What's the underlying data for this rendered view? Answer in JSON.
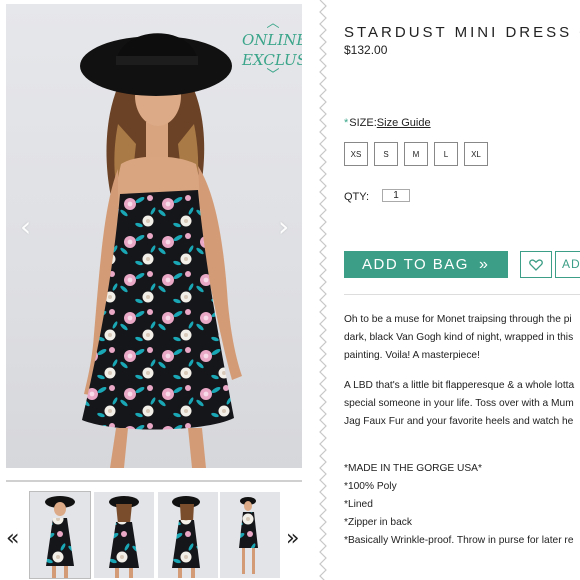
{
  "gallery": {
    "badge": {
      "line1": "ONLINE",
      "line2": "EXCLUSIVE",
      "chevron_up": "︿",
      "chevron_down": "﹀"
    },
    "prev_arrow": "‹",
    "next_arrow": "›",
    "thumbs_prev": "«",
    "thumbs_next": "»"
  },
  "product": {
    "title": "STARDUST MINI DRESS ~",
    "price": "$132.00",
    "size_required_mark": "*",
    "size_label": "SIZE:",
    "size_guide_link": "Size Guide",
    "sizes": [
      "XS",
      "S",
      "M",
      "L",
      "XL"
    ],
    "qty_label": "QTY:",
    "qty_value": "1",
    "add_to_bag_label": "ADD TO BAG",
    "add_to_bag_chevrons": "»",
    "secondary_button_label": "AD"
  },
  "description": {
    "paragraph1": [
      "Oh to be a muse for Monet traipsing through the pi",
      "dark, black Van Gogh kind of night, wrapped in this",
      "painting. Voila! A masterpiece!"
    ],
    "paragraph2": [
      "A LBD that's a little bit flapperesque & a whole lotta",
      "special someone in your life. Toss over with a Mum",
      "Jag Faux Fur and your favorite heels and watch he"
    ],
    "features": [
      "*MADE IN THE GORGE USA*",
      "*100% Poly",
      "*Lined",
      "*Zipper in back",
      "*Basically Wrinkle-proof. Throw in purse for later re"
    ]
  },
  "colors": {
    "accent": "#3c9e86",
    "dress_black": "#15161a",
    "flower_pink": "#e9a8c6",
    "leaf_teal": "#1aa7b5"
  }
}
